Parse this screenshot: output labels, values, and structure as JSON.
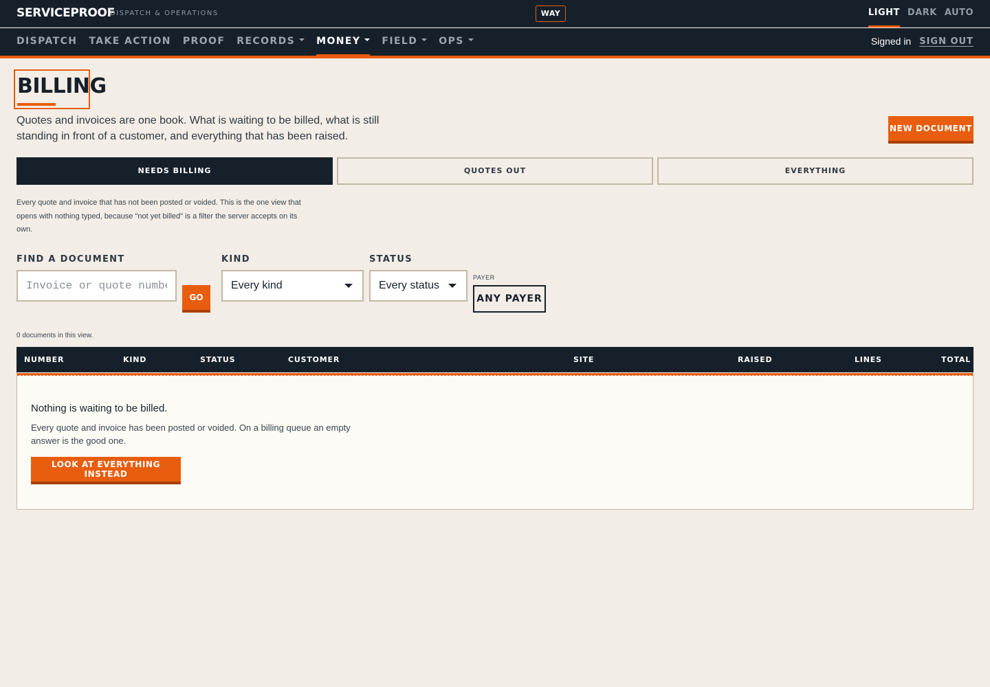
{
  "topbar": {
    "brand": "SERVICEPROOF",
    "brand_sub": "DISPATCH & OPERATIONS",
    "badge": "WAY",
    "theme_options": [
      "LIGHT",
      "DARK",
      "AUTO"
    ],
    "active_theme": "LIGHT"
  },
  "nav": {
    "items": [
      {
        "label": "DISPATCH",
        "dropdown": false
      },
      {
        "label": "TAKE ACTION",
        "dropdown": false
      },
      {
        "label": "PROOF",
        "dropdown": false
      },
      {
        "label": "RECORDS",
        "dropdown": true
      },
      {
        "label": "MONEY",
        "dropdown": true
      },
      {
        "label": "FIELD",
        "dropdown": true
      },
      {
        "label": "OPS",
        "dropdown": true
      }
    ],
    "active": "MONEY",
    "signed_in": "Signed in",
    "sign_out": "SIGN OUT"
  },
  "page": {
    "title": "BILLING",
    "intro": "Quotes and invoices are one book. What is waiting to be billed, what is still standing in front of a customer, and everything that has been raised.",
    "new_button": "NEW DOCUMENT"
  },
  "tabs": {
    "items": [
      "NEEDS BILLING",
      "QUOTES OUT",
      "EVERYTHING"
    ],
    "active": "NEEDS BILLING",
    "description": "Every quote and invoice that has not been posted or voided. This is the one view that opens with nothing typed, because \"not yet billed\" is a filter the server accepts on its own."
  },
  "filters": {
    "find_label": "FIND A DOCUMENT",
    "find_placeholder": "Invoice or quote number",
    "find_value": "",
    "go_button": "GO",
    "kind_label": "KIND",
    "kind_value": "Every kind",
    "status_label": "STATUS",
    "status_value": "Every status",
    "payer_label": "PAYER",
    "payer_button": "ANY PAYER"
  },
  "results": {
    "count_text": "0 documents in this view."
  },
  "table": {
    "columns": [
      "NUMBER",
      "KIND",
      "STATUS",
      "CUSTOMER",
      "SITE",
      "RAISED",
      "LINES",
      "TOTAL"
    ],
    "rows": [],
    "empty_title": "Nothing is waiting to be billed.",
    "empty_text": "Every quote and invoice has been posted or voided. On a billing queue an empty answer is the good one.",
    "empty_button": "LOOK AT EVERYTHING INSTEAD"
  },
  "colors": {
    "accent": "#e85d0e",
    "navy": "#16202a",
    "background": "#f2ede6"
  }
}
